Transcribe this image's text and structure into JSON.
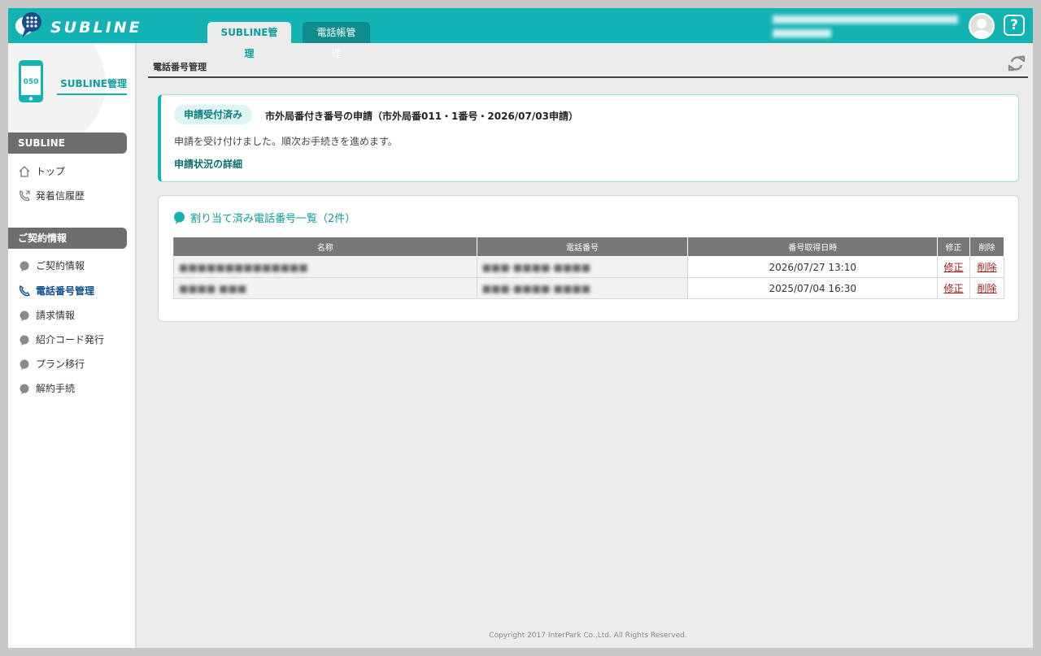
{
  "header": {
    "logo_text": "SUBLINE",
    "tabs": [
      {
        "label": "SUBLINE管理",
        "active": true
      },
      {
        "label": "電話帳管理",
        "active": false
      }
    ],
    "help_label": "?"
  },
  "sidebar": {
    "title": "SUBLINE管理",
    "phone_number_prefix": "050",
    "sections": [
      {
        "title": "SUBLINE",
        "items": [
          {
            "label": "トップ",
            "icon": "home-icon"
          },
          {
            "label": "発着信履歴",
            "icon": "phone-log-icon"
          }
        ]
      },
      {
        "title": "ご契約情報",
        "items": [
          {
            "label": "ご契約情報",
            "icon": "bullet-icon"
          },
          {
            "label": "電話番号管理",
            "icon": "phone-icon",
            "active": true
          },
          {
            "label": "請求情報",
            "icon": "bullet-icon"
          },
          {
            "label": "紹介コード発行",
            "icon": "bullet-icon"
          },
          {
            "label": "プラン移行",
            "icon": "bullet-icon"
          },
          {
            "label": "解約手続",
            "icon": "bullet-icon"
          }
        ]
      }
    ]
  },
  "main": {
    "page_title": "電話番号管理",
    "notice": {
      "badge": "申請受付済み",
      "title": "市外局番付き番号の申請（市外局番011・1番号・2026/07/03申請）",
      "message": "申請を受け付けました。順次お手続きを進めます。",
      "link": "申請状況の詳細"
    },
    "list": {
      "heading": "割り当て済み電話番号一覧（2件）",
      "columns": [
        "名称",
        "電話番号",
        "番号取得日時",
        "修正",
        "削除"
      ],
      "rows": [
        {
          "name": "■■■■■■■■■■■■■■",
          "phone": "■■■-■■■■-■■■■",
          "acquired": "2026/07/27 13:10",
          "edit": "修正",
          "delete": "削除"
        },
        {
          "name": "■■■■ ■■■",
          "phone": "■■■-■■■■-■■■■",
          "acquired": "2025/07/04 16:30",
          "edit": "修正",
          "delete": "削除"
        }
      ]
    }
  },
  "footer": "Copyright 2017 InterPark Co.,Ltd. All Rights Reserved.",
  "colors": {
    "accent": "#14b3b3",
    "link_red": "#a01818",
    "nav_active": "#0d4e8f"
  }
}
